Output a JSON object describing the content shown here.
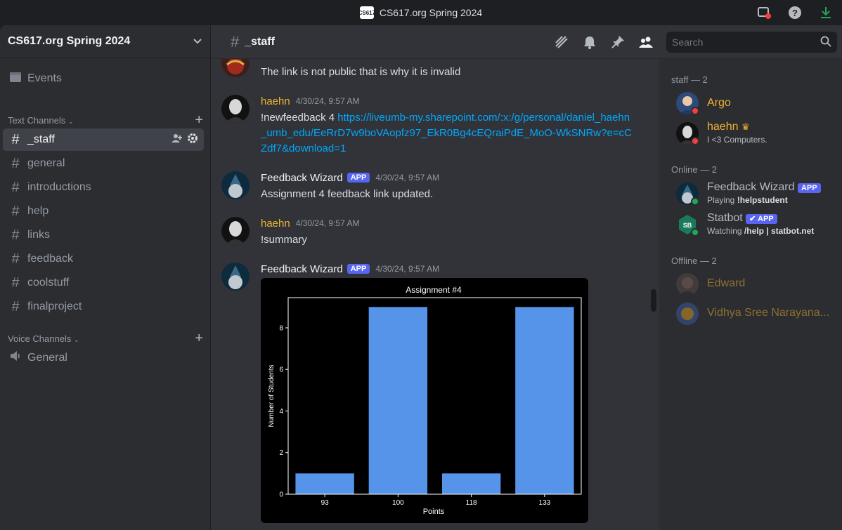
{
  "window": {
    "title": "CS617.org Spring 2024",
    "logo_text": "CS617"
  },
  "server": {
    "name": "CS617.org Spring 2024"
  },
  "sidebar": {
    "events_label": "Events",
    "text_category": "Text Channels",
    "voice_category": "Voice Channels",
    "text_channels": [
      "_staff",
      "general",
      "introductions",
      "help",
      "links",
      "feedback",
      "coolstuff",
      "finalproject"
    ],
    "active_channel": "_staff",
    "voice_channels": [
      "General"
    ]
  },
  "header": {
    "channel": "_staff",
    "search_placeholder": "Search"
  },
  "messages": [
    {
      "author": "",
      "timestamp": "",
      "text": "The link is not public that is why it is invalid"
    },
    {
      "author": "haehn",
      "timestamp": "4/30/24, 9:57 AM",
      "text_prefix": "!newfeedback 4 ",
      "link": "https://liveumb-my.sharepoint.com/:x:/g/personal/daniel_haehn_umb_edu/EeRrD7w9boVAopfz97_EkR0Bg4cEQraiPdE_MoO-WkSNRw?e=cCZdf7&download=1"
    },
    {
      "author": "Feedback Wizard",
      "badge": "APP",
      "timestamp": "4/30/24, 9:57 AM",
      "text": "Assignment 4 feedback link updated."
    },
    {
      "author": "haehn",
      "timestamp": "4/30/24, 9:57 AM",
      "text": "!summary"
    },
    {
      "author": "Feedback Wizard",
      "badge": "APP",
      "timestamp": "4/30/24, 9:57 AM",
      "text": ""
    }
  ],
  "chart_data": {
    "type": "bar",
    "title": "Assignment #4",
    "xlabel": "Points",
    "ylabel": "Number of Students",
    "categories": [
      "93",
      "100",
      "118",
      "133"
    ],
    "values": [
      1,
      9,
      1,
      9
    ],
    "ylim": [
      0,
      9.45
    ],
    "yticks": [
      0,
      2,
      4,
      6,
      8
    ],
    "bar_color": "#5594e8",
    "background": "#000000"
  },
  "members": {
    "groups": [
      {
        "label": "staff — 2",
        "items": [
          {
            "name": "Argo",
            "color": "#f0b232",
            "status": "dnd",
            "sub_prefix": "",
            "sub_bold": ""
          },
          {
            "name": "haehn",
            "color": "#f0b232",
            "status": "dnd",
            "crown": "♛",
            "sub_prefix": "I <3 Computers.",
            "sub_bold": ""
          }
        ]
      },
      {
        "label": "Online — 2",
        "items": [
          {
            "name": "Feedback Wizard",
            "color": "#b5bac1",
            "status": "online",
            "badge": "APP",
            "sub_prefix": "Playing ",
            "sub_bold": "!helpstudent"
          },
          {
            "name": "Statbot",
            "color": "#b5bac1",
            "status": "online",
            "badge": "✔ APP",
            "sub_prefix": "Watching ",
            "sub_bold": "/help | statbot.net"
          }
        ]
      },
      {
        "label": "Offline — 2",
        "items": [
          {
            "name": "Edward",
            "color": "#f0b232",
            "status": "offline"
          },
          {
            "name": "Vidhya Sree Narayana...",
            "color": "#f0b232",
            "status": "offline"
          }
        ]
      }
    ]
  },
  "colors": {
    "accent": "#5865f2",
    "link": "#00a8fc",
    "staff_name": "#f0b232",
    "online": "#23a55a",
    "dnd": "#f23f43"
  }
}
